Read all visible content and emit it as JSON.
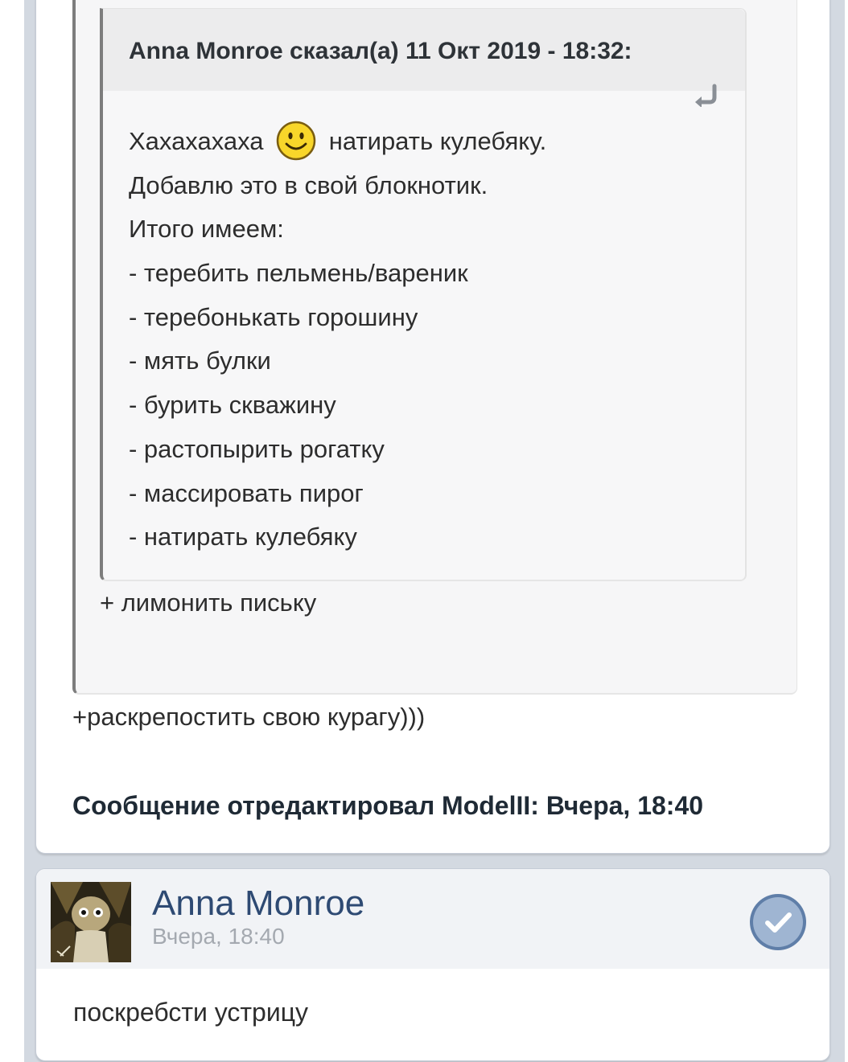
{
  "quote_inner": {
    "header": "Anna Monroe сказал(а) 11 Окт 2019 - 18:32:",
    "line_laugh": "Хахахахаха",
    "line_laugh_rest": "натирать кулебяку.",
    "lines": [
      "Добавлю это в свой блокнотик.",
      "Итого имеем:",
      "- теребить пельмень/вареник",
      "- теребонькать горошину",
      "- мять булки",
      "- бурить скважину",
      "- растопырить рогатку",
      "- массировать пирог",
      "- натирать кулебяку"
    ],
    "icons": {
      "reply": "reply-arrow-icon",
      "smiley": "smiley-icon"
    }
  },
  "quote_outer": {
    "text": "+ лимонить письку"
  },
  "post": {
    "text": "+раскрепостить свою курагу)))",
    "edit_note": "Сообщение отредактировал ModelII: Вчера, 18:40"
  },
  "reply_post": {
    "username": "Anna Monroe",
    "time": "Вчера, 18:40",
    "text": "поскребсти устрицу",
    "icons": {
      "avatar": "avatar-image",
      "check": "check-circle-icon"
    }
  },
  "colors": {
    "page_background": "#d3d9e1",
    "card": "#ffffff",
    "quote_bg": "#f6f6f7",
    "quote_header": "#ececed",
    "quote_border": "#7d7d7d",
    "username": "#2e4a73",
    "timestamp": "#a4a9b0",
    "check_button": "#8da6c8"
  }
}
